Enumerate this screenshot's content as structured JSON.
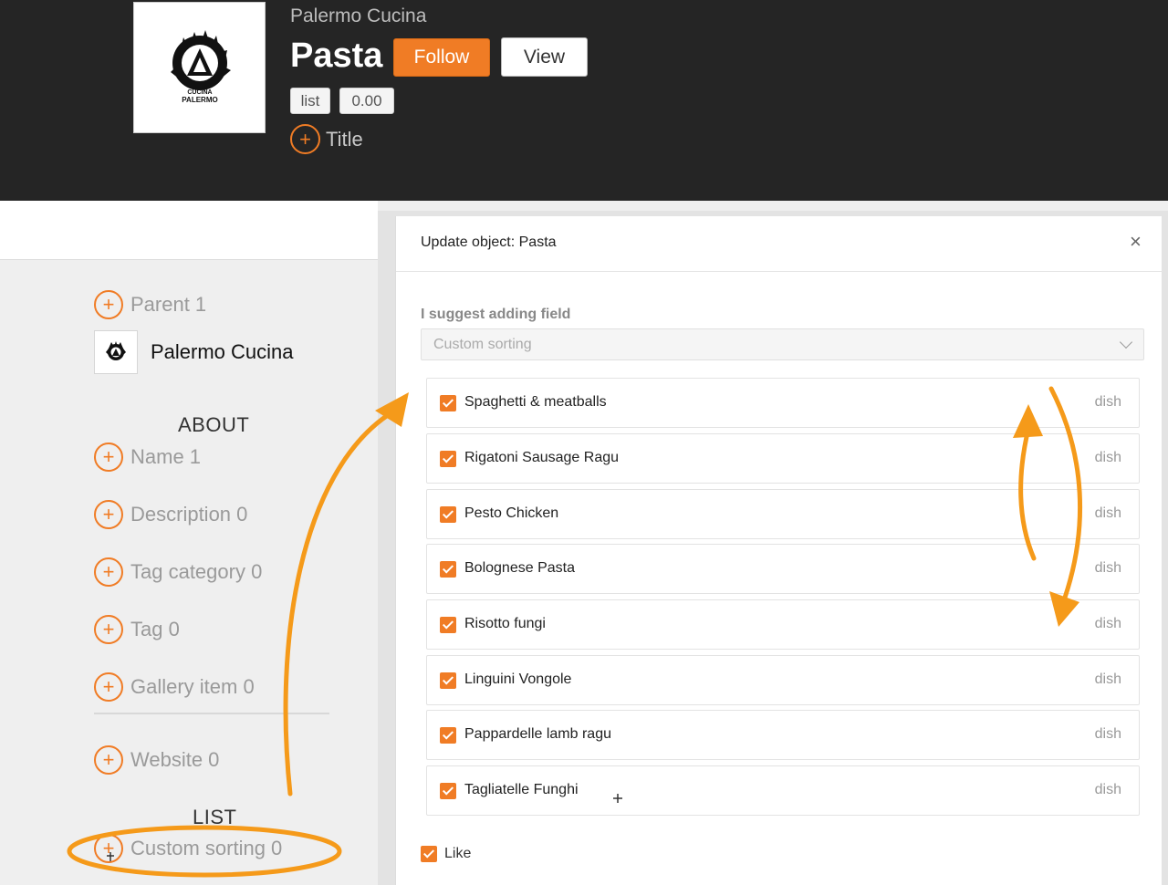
{
  "header": {
    "breadcrumb": "Palermo Cucina",
    "title": "Pasta",
    "follow_label": "Follow",
    "view_label": "View",
    "chips": [
      "list",
      "0.00"
    ],
    "add_title_label": "Title",
    "logo_text": "CUCINA PALERMO"
  },
  "sidebar": {
    "parent_label": "Parent 1",
    "parent_name": "Palermo Cucina",
    "about_heading": "ABOUT",
    "about_items": [
      {
        "label": "Name 1"
      },
      {
        "label": "Description 0"
      },
      {
        "label": "Tag category 0"
      },
      {
        "label": "Tag 0"
      },
      {
        "label": "Gallery item 0"
      },
      {
        "label": "Website 0"
      }
    ],
    "list_heading": "LIST",
    "list_items": [
      {
        "label": "Custom sorting 0"
      }
    ]
  },
  "modal": {
    "title": "Update object: Pasta",
    "close_icon": "×",
    "suggest_label": "I suggest adding field",
    "suggest_value": "Custom sorting",
    "dishes": [
      {
        "name": "Spaghetti & meatballs",
        "type": "dish",
        "checked": true
      },
      {
        "name": "Rigatoni Sausage Ragu",
        "type": "dish",
        "checked": true
      },
      {
        "name": "Pesto Chicken",
        "type": "dish",
        "checked": true
      },
      {
        "name": "Bolognese Pasta",
        "type": "dish",
        "checked": true
      },
      {
        "name": "Risotto fungi",
        "type": "dish",
        "checked": true
      },
      {
        "name": "Linguini Vongole",
        "type": "dish",
        "checked": true
      },
      {
        "name": "Pappardelle lamb ragu",
        "type": "dish",
        "checked": true
      },
      {
        "name": "Tagliatelle Funghi",
        "type": "dish",
        "checked": true
      }
    ],
    "like_label": "Like"
  },
  "colors": {
    "accent": "#f07c25",
    "header_bg": "#252525",
    "annotation": "#f59a1a"
  }
}
